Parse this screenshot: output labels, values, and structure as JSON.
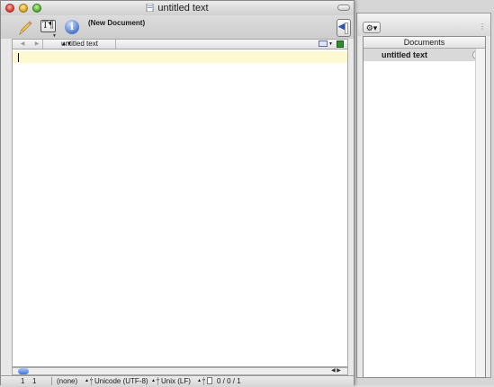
{
  "window": {
    "title": "untitled text"
  },
  "toolbar": {
    "pencil_icon": "pencil-icon",
    "text_style_glyph": "T¶",
    "info_glyph": "i",
    "document_label": "(New Document)"
  },
  "navbar": {
    "document_popup": "untitled text"
  },
  "drawer": {
    "header": "Documents",
    "items": [
      {
        "label": "untitled text"
      }
    ],
    "close_glyph": "×"
  },
  "status": {
    "line": "1",
    "column": "1",
    "syntax": "(none)",
    "encoding": "Unicode (UTF-8)",
    "line_endings": "Unix (LF)",
    "counts": "0 / 0 / 1"
  },
  "colors": {
    "current_line_highlight": "#fdfad1",
    "selected_row": "#d9d9d9",
    "accent_blue": "#3a74d8"
  }
}
